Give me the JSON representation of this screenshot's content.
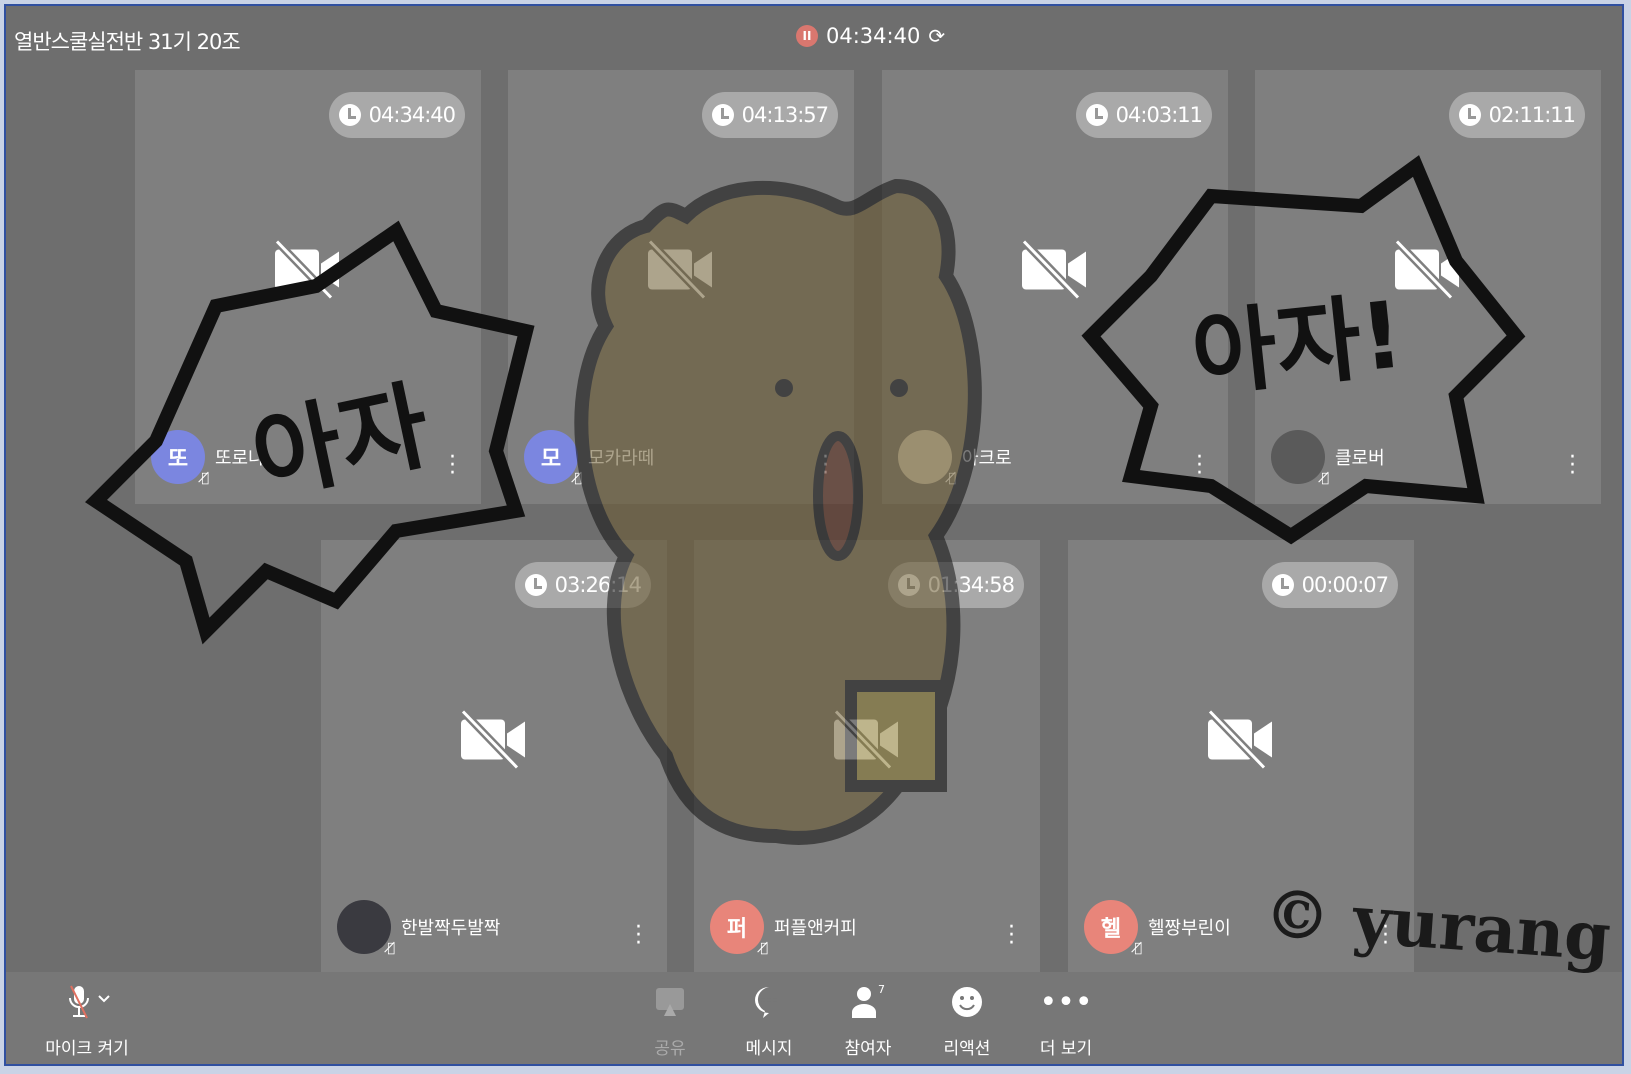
{
  "meeting_title": "열반스쿨실전반 31기 20조",
  "recording": {
    "icon": "pause-icon",
    "elapsed": "04:34:40"
  },
  "participants": [
    {
      "name": "또로나",
      "initial": "또",
      "timer": "04:34:40",
      "avatar_color": "#7b86e0"
    },
    {
      "name": "모카라떼",
      "initial": "모",
      "timer": "04:13:57",
      "avatar_color": "#7b86e0"
    },
    {
      "name": "아크로",
      "initial": "",
      "timer": "04:03:11",
      "avatar_color": "#d8d0c0"
    },
    {
      "name": "클로버",
      "initial": "",
      "timer": "02:11:11",
      "avatar_color": "#5a5a5a"
    },
    {
      "name": "한발짝두발짝",
      "initial": "",
      "timer": "03:26:14",
      "avatar_color": "#3a3a40"
    },
    {
      "name": "퍼플앤커피",
      "initial": "퍼",
      "timer": "01:34:58",
      "avatar_color": "#e8857a"
    },
    {
      "name": "헬짱부린이",
      "initial": "헬",
      "timer": "00:00:07",
      "avatar_color": "#e8857a"
    }
  ],
  "toolbar": {
    "left_cut": "기",
    "mic": "마이크 켜기",
    "share": "공유",
    "message": "메시지",
    "participants": "참여자",
    "participants_count": "7",
    "reaction": "리액션",
    "more": "더 보기"
  },
  "sticker": {
    "bubble_left": "아자",
    "bubble_right": "아자!",
    "watermark": "© yurang"
  }
}
